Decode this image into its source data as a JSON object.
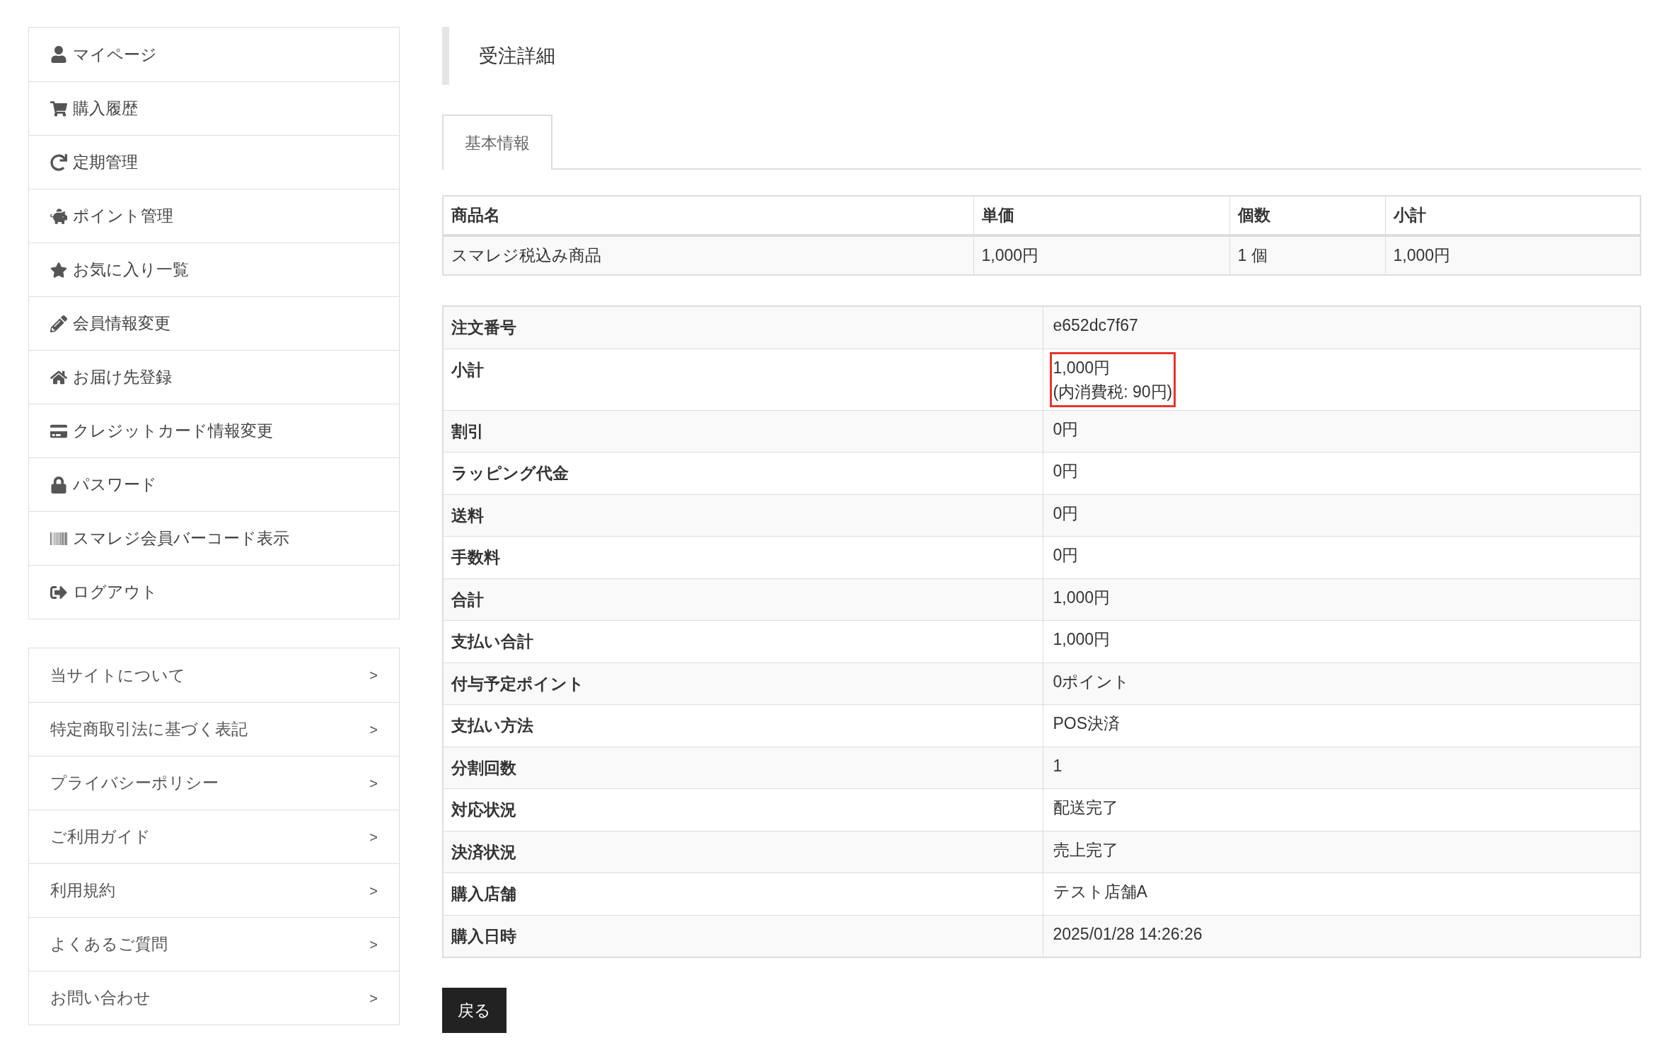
{
  "member_menu": [
    {
      "label": "マイページ"
    },
    {
      "label": "購入履歴"
    },
    {
      "label": "定期管理"
    },
    {
      "label": "ポイント管理"
    },
    {
      "label": "お気に入り一覧"
    },
    {
      "label": "会員情報変更"
    },
    {
      "label": "お届け先登録"
    },
    {
      "label": "クレジットカード情報変更"
    },
    {
      "label": "パスワード"
    },
    {
      "label": "スマレジ会員バーコード表示"
    },
    {
      "label": "ログアウト"
    }
  ],
  "info_menu": [
    {
      "label": "当サイトについて",
      "arrow": ">"
    },
    {
      "label": "特定商取引法に基づく表記",
      "arrow": ">"
    },
    {
      "label": "プライバシーポリシー",
      "arrow": ">"
    },
    {
      "label": "ご利用ガイド",
      "arrow": ">"
    },
    {
      "label": "利用規約",
      "arrow": ">"
    },
    {
      "label": "よくあるご質問",
      "arrow": ">"
    },
    {
      "label": "お問い合わせ",
      "arrow": ">"
    }
  ],
  "page_title": "受注詳細",
  "tabs": [
    {
      "label": "基本情報",
      "selected": true
    }
  ],
  "items_table": {
    "columns": [
      "商品名",
      "単価",
      "個数",
      "小計"
    ],
    "rows": [
      [
        "スマレジ税込み商品",
        "1,000円",
        "1 個",
        "1,000円"
      ]
    ]
  },
  "details": [
    {
      "label": "注文番号",
      "value": [
        "e652dc7f67"
      ],
      "highlighted": false
    },
    {
      "label": "小計",
      "value": [
        "1,000円",
        "(内消費税: 90円)"
      ],
      "highlighted": true
    },
    {
      "label": "割引",
      "value": [
        "0円"
      ],
      "highlighted": false
    },
    {
      "label": "ラッピング代金",
      "value": [
        "0円"
      ],
      "highlighted": false
    },
    {
      "label": "送料",
      "value": [
        "0円"
      ],
      "highlighted": false
    },
    {
      "label": "手数料",
      "value": [
        "0円"
      ],
      "highlighted": false
    },
    {
      "label": "合計",
      "value": [
        "1,000円"
      ],
      "highlighted": false
    },
    {
      "label": "支払い合計",
      "value": [
        "1,000円"
      ],
      "highlighted": false
    },
    {
      "label": "付与予定ポイント",
      "value": [
        "0ポイント"
      ],
      "highlighted": false
    },
    {
      "label": "支払い方法",
      "value": [
        "POS決済"
      ],
      "highlighted": false
    },
    {
      "label": "分割回数",
      "value": [
        "1"
      ],
      "highlighted": false
    },
    {
      "label": "対応状況",
      "value": [
        "配送完了"
      ],
      "highlighted": false
    },
    {
      "label": "決済状況",
      "value": [
        "売上完了"
      ],
      "highlighted": false
    },
    {
      "label": "購入店舗",
      "value": [
        "テスト店舗A"
      ],
      "highlighted": false
    },
    {
      "label": "購入日時",
      "value": [
        "2025/01/28 14:26:26"
      ],
      "highlighted": false
    }
  ],
  "back_button": "戻る"
}
